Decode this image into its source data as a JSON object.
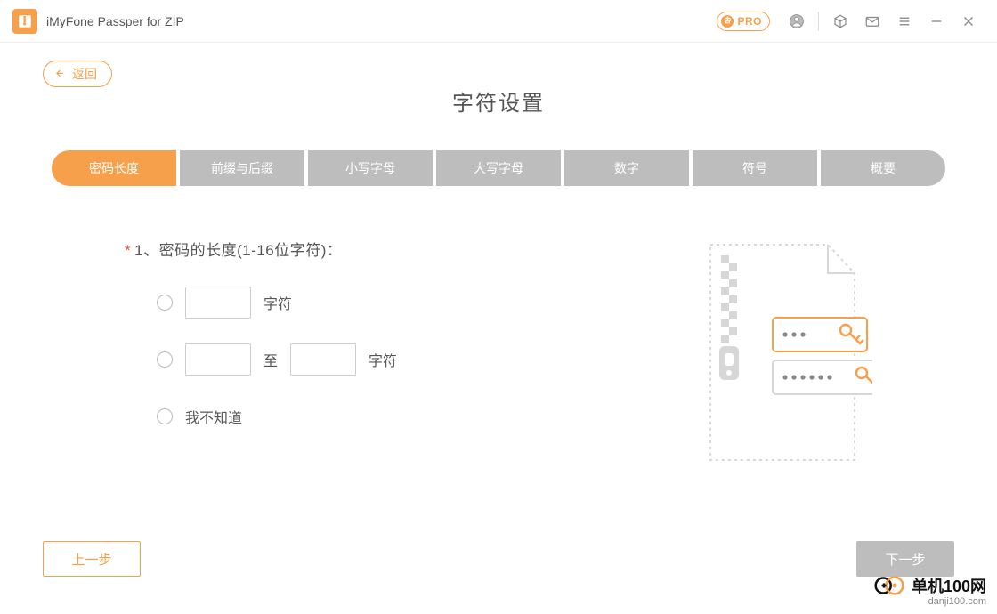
{
  "app": {
    "title": "iMyFone Passper for ZIP",
    "pro_label": "PRO"
  },
  "header": {
    "back_label": "返回",
    "page_title": "字符设置"
  },
  "tabs": [
    {
      "label": "密码长度",
      "active": true
    },
    {
      "label": "前缀与后缀",
      "active": false
    },
    {
      "label": "小写字母",
      "active": false
    },
    {
      "label": "大写字母",
      "active": false
    },
    {
      "label": "数字",
      "active": false
    },
    {
      "label": "符号",
      "active": false
    },
    {
      "label": "概要",
      "active": false
    }
  ],
  "form": {
    "section_prefix": "*",
    "section_label": "1、密码的长度(1-16位字符)：",
    "exact": {
      "value": "",
      "unit_label": "字符"
    },
    "range": {
      "from_value": "",
      "to_label": "至",
      "to_value": "",
      "unit_label": "字符"
    },
    "unknown_label": "我不知道"
  },
  "footer": {
    "prev_label": "上一步",
    "next_label": "下一步"
  },
  "watermark": {
    "brand": "单机100网",
    "url": "danji100.com"
  }
}
